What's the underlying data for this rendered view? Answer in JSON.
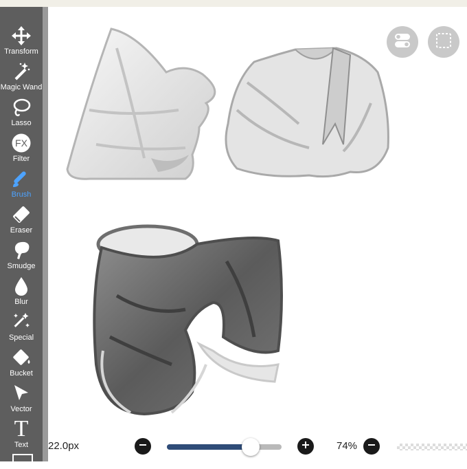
{
  "tools": [
    {
      "label": "Transform",
      "icon": "move-arrows-icon",
      "active": false
    },
    {
      "label": "Magic Wand",
      "icon": "magic-wand-icon",
      "active": false
    },
    {
      "label": "Lasso",
      "icon": "lasso-icon",
      "active": false
    },
    {
      "label": "Filter",
      "icon": "fx-icon",
      "icon_text": "FX",
      "active": false
    },
    {
      "label": "Brush",
      "icon": "brush-icon",
      "active": true
    },
    {
      "label": "Eraser",
      "icon": "eraser-icon",
      "active": false
    },
    {
      "label": "Smudge",
      "icon": "smudge-icon",
      "active": false
    },
    {
      "label": "Blur",
      "icon": "blur-drop-icon",
      "active": false
    },
    {
      "label": "Special",
      "icon": "sparkle-icon",
      "active": false
    },
    {
      "label": "Bucket",
      "icon": "bucket-icon",
      "active": false
    },
    {
      "label": "Vector",
      "icon": "vector-arrow-icon",
      "active": false
    },
    {
      "label": "Text",
      "icon": "text-t-icon",
      "icon_text": "T",
      "active": false
    }
  ],
  "bottom": {
    "brush_size": "22.0px",
    "brush_opacity_fraction": 0.73,
    "zoom": "74%"
  },
  "colors": {
    "toolbar_bg": "#5e5e5e",
    "active_tool": "#4da3ff",
    "slider_fill": "#2f4c78"
  }
}
